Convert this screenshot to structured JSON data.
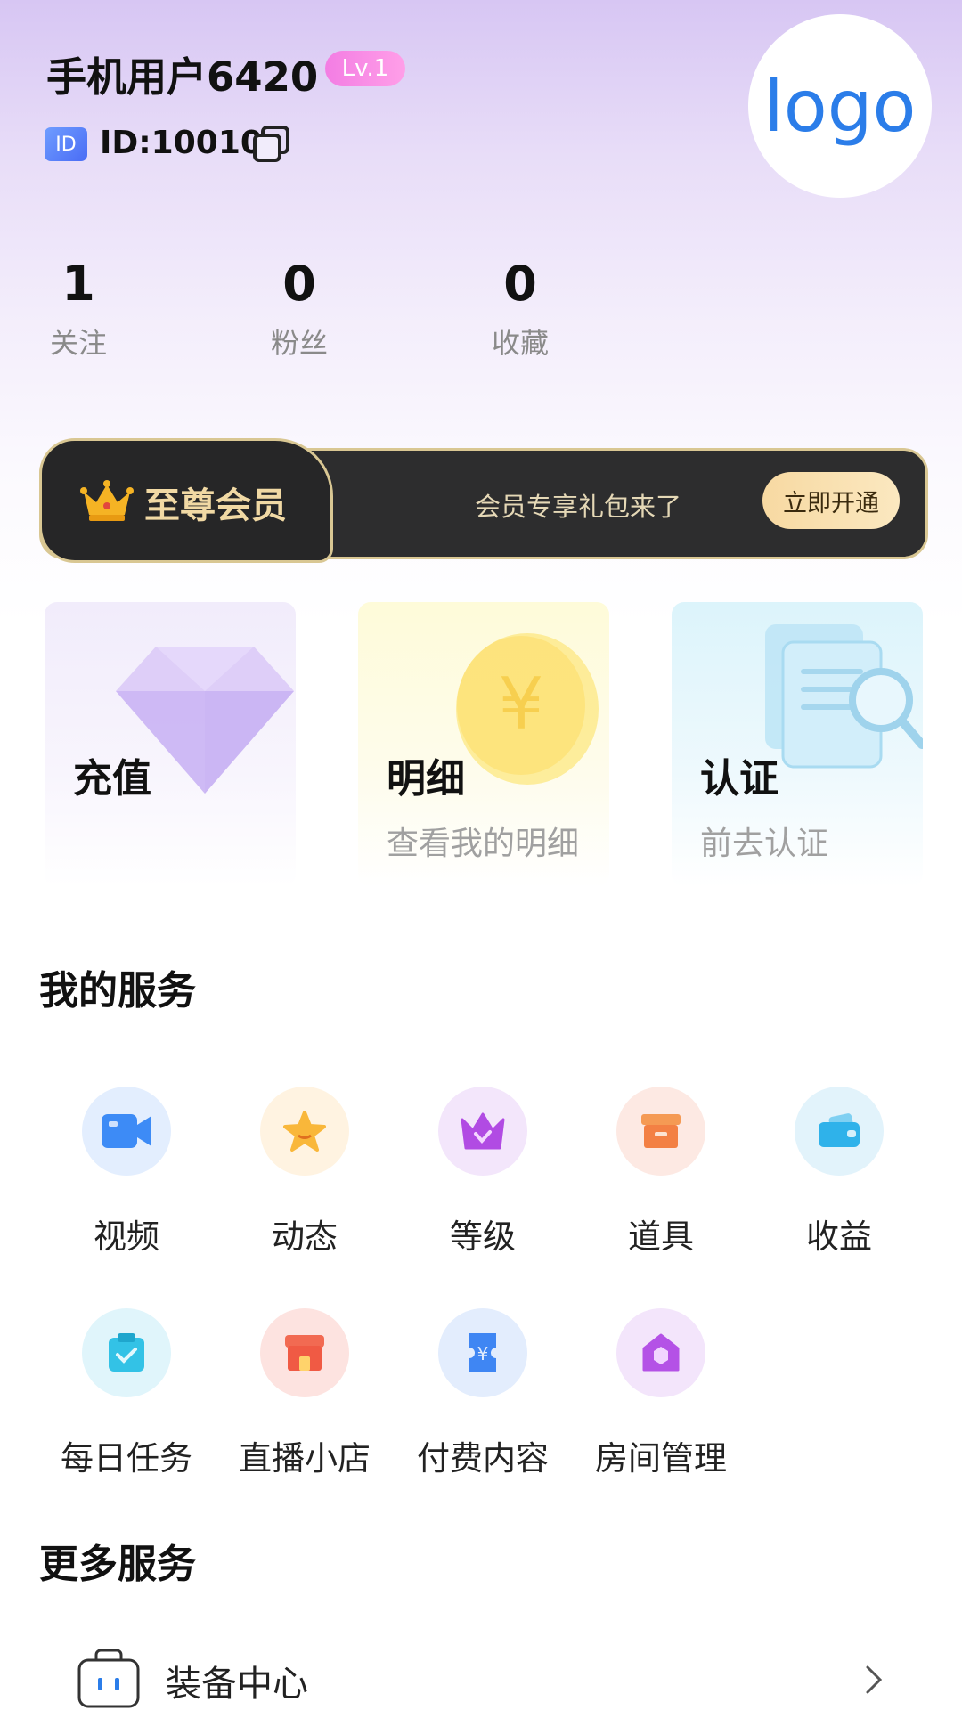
{
  "profile": {
    "username": "手机用户6420",
    "level": "Lv.1",
    "id_badge": "ID",
    "user_id": "ID:10010",
    "logo_text": "logo"
  },
  "stats": [
    {
      "value": "1",
      "label": "关注"
    },
    {
      "value": "0",
      "label": "粉丝"
    },
    {
      "value": "0",
      "label": "收藏"
    }
  ],
  "vip": {
    "title": "至尊会员",
    "promo": "会员专享礼包来了",
    "button": "立即开通"
  },
  "cards": [
    {
      "title": "充值",
      "subtitle": ""
    },
    {
      "title": "明细",
      "subtitle": "查看我的明细"
    },
    {
      "title": "认证",
      "subtitle": "前去认证"
    }
  ],
  "my_services": {
    "title": "我的服务",
    "items": [
      {
        "label": "视频",
        "icon": "video-camera-icon"
      },
      {
        "label": "动态",
        "icon": "star-icon"
      },
      {
        "label": "等级",
        "icon": "crown-icon"
      },
      {
        "label": "道具",
        "icon": "box-icon"
      },
      {
        "label": "收益",
        "icon": "wallet-icon"
      },
      {
        "label": "每日任务",
        "icon": "task-icon"
      },
      {
        "label": "直播小店",
        "icon": "shop-icon"
      },
      {
        "label": "付费内容",
        "icon": "ticket-icon"
      },
      {
        "label": "房间管理",
        "icon": "room-icon"
      }
    ]
  },
  "more_services": {
    "title": "更多服务",
    "items": [
      {
        "label": "装备中心",
        "icon": "bag-icon"
      }
    ]
  },
  "colors": {
    "accent_blue": "#2b7de9",
    "vip_gold": "#f1d9a4",
    "level_pink": "#f37de3"
  }
}
